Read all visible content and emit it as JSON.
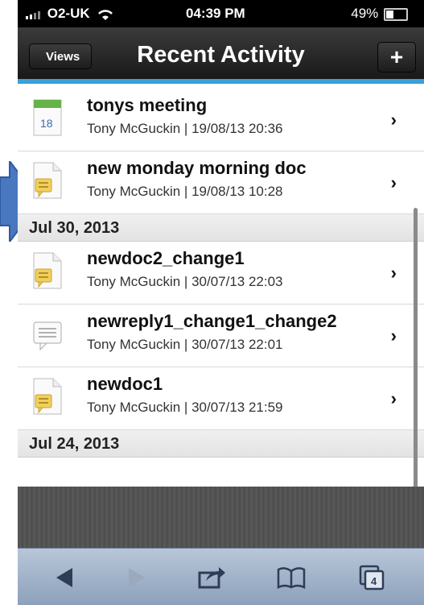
{
  "status_bar": {
    "carrier": "O2-UK",
    "time": "04:39 PM",
    "battery": "49%"
  },
  "nav": {
    "back_label": "Views",
    "title": "Recent Activity",
    "add_label": "+"
  },
  "items_top": [
    {
      "title": "tonys meeting",
      "meta": "Tony McGuckin | 19/08/13 20:36",
      "icon": "calendar-icon",
      "calendar_day": "18"
    },
    {
      "title": "new monday morning doc",
      "meta": "Tony McGuckin | 19/08/13 10:28",
      "icon": "document-icon"
    }
  ],
  "sections": [
    {
      "header": "Jul 30, 2013",
      "items": [
        {
          "title": "newdoc2_change1",
          "meta": "Tony McGuckin | 30/07/13 22:03",
          "icon": "document-icon"
        },
        {
          "title": "newreply1_change1_change2",
          "meta": "Tony McGuckin | 30/07/13 22:01",
          "icon": "reply-icon"
        },
        {
          "title": "newdoc1",
          "meta": "Tony McGuckin | 30/07/13 21:59",
          "icon": "document-icon"
        }
      ]
    },
    {
      "header": "Jul 24, 2013",
      "items": []
    }
  ],
  "toolbar": {
    "tabs_count": "4"
  },
  "colors": {
    "accent_bar": "#3aa0d8",
    "annotation_arrow": "#4a78c0",
    "doc_badge": "#f2cf5b",
    "calendar_top": "#66b34a"
  }
}
